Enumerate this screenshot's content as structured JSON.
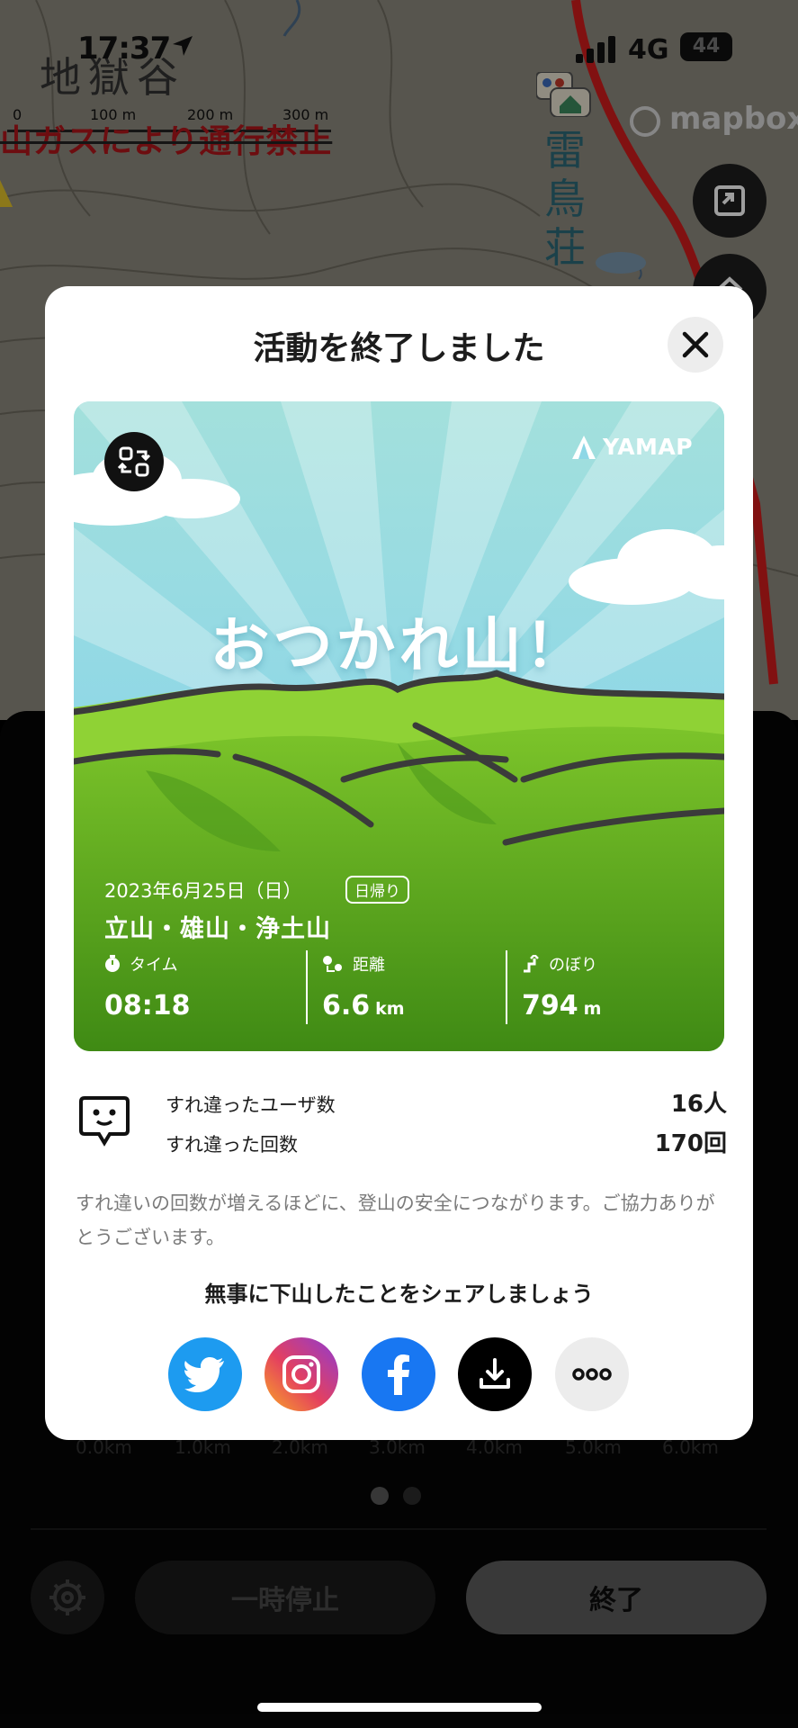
{
  "status_bar": {
    "time": "17:37",
    "network": "4G",
    "battery": "44"
  },
  "map": {
    "place_name": "地獄谷",
    "hut_name": "雷鳥荘",
    "road_warning": "山ガスにより通行禁止",
    "scale_labels": [
      "0",
      "100 m",
      "200 m",
      "300 m"
    ],
    "attribution": "mapbox"
  },
  "sheet": {
    "axis_labels": [
      "0.0km",
      "1.0km",
      "2.0km",
      "3.0km",
      "4.0km",
      "5.0km",
      "6.0km"
    ],
    "pause_label": "一時停止",
    "end_label": "終了"
  },
  "modal": {
    "title": "活動を終了しました",
    "card": {
      "brand": "YAMAP",
      "headline": "おつかれ山！",
      "date": "2023年6月25日（日）",
      "trip_type": "日帰り",
      "mountains": "立山・雄山・浄土山",
      "stats": [
        {
          "label": "タイム",
          "value": "08:18",
          "unit": ""
        },
        {
          "label": "距離",
          "value": "6.6",
          "unit": "km"
        },
        {
          "label": "のぼり",
          "value": "794",
          "unit": "m"
        }
      ]
    },
    "passing": {
      "users_label": "すれ違ったユーザ数",
      "users_value": "16人",
      "count_label": "すれ違った回数",
      "count_value": "170回"
    },
    "note": "すれ違いの回数が増えるほどに、登山の安全につながります。ご協力ありがとうございます。",
    "share_title": "無事に下山したことをシェアしましょう",
    "share_buttons": [
      "twitter-icon",
      "instagram-icon",
      "facebook-icon",
      "download-icon",
      "more-icon"
    ]
  },
  "colors": {
    "route": "#d01c1c",
    "sky": "#9ddde4",
    "grass": "#6fb51f",
    "twitter": "#1d9bf0",
    "facebook": "#1877f2"
  }
}
